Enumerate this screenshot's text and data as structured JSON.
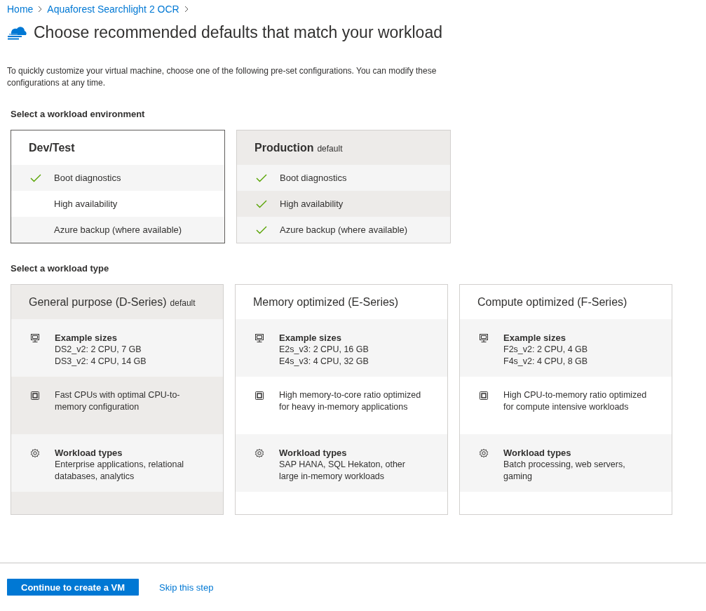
{
  "breadcrumb": [
    {
      "label": "Home"
    },
    {
      "label": "Aquaforest Searchlight 2 OCR"
    }
  ],
  "title": "Choose recommended defaults that match your workload",
  "description": "To quickly customize your virtual machine, choose one of the following pre-set configurations. You can modify these configurations at any time.",
  "environment_section": {
    "label": "Select a workload environment",
    "cards": [
      {
        "title": "Dev/Test",
        "selected": true,
        "shaded": false,
        "features": [
          {
            "label": "Boot diagnostics",
            "checked": true
          },
          {
            "label": "High availability",
            "checked": false
          },
          {
            "label": "Azure backup (where available)",
            "checked": false
          }
        ]
      },
      {
        "title": "Production",
        "tag": "default",
        "selected": false,
        "shaded": true,
        "features": [
          {
            "label": "Boot diagnostics",
            "checked": true
          },
          {
            "label": "High availability",
            "checked": true
          },
          {
            "label": "Azure backup (where available)",
            "checked": true
          }
        ]
      }
    ]
  },
  "type_section": {
    "label": "Select a workload type",
    "cards": [
      {
        "title": "General purpose (D-Series)",
        "tag": "default",
        "selected": false,
        "shaded": true,
        "rows": [
          {
            "kind": "sizes",
            "heading": "Example sizes",
            "lines": [
              "DS2_v2: 2 CPU, 7 GB",
              "DS3_v2: 4 CPU, 14 GB"
            ]
          },
          {
            "kind": "cpu",
            "lines": [
              "Fast CPUs with optimal CPU-to-memory configuration"
            ]
          },
          {
            "kind": "workloads",
            "heading": "Workload types",
            "lines": [
              "Enterprise applications, relational databases, analytics"
            ]
          }
        ]
      },
      {
        "title": "Memory optimized (E-Series)",
        "selected": false,
        "shaded": false,
        "rows": [
          {
            "kind": "sizes",
            "heading": "Example sizes",
            "lines": [
              "E2s_v3: 2 CPU, 16 GB",
              "E4s_v3: 4 CPU, 32 GB"
            ]
          },
          {
            "kind": "cpu",
            "lines": [
              "High memory-to-core ratio optimized for heavy in-memory applications"
            ]
          },
          {
            "kind": "workloads",
            "heading": "Workload types",
            "lines": [
              "SAP HANA, SQL Hekaton, other large in-memory workloads"
            ]
          }
        ]
      },
      {
        "title": "Compute optimized (F-Series)",
        "selected": false,
        "shaded": false,
        "rows": [
          {
            "kind": "sizes",
            "heading": "Example sizes",
            "lines": [
              "F2s_v2: 2 CPU, 4 GB",
              "F4s_v2: 4 CPU, 8 GB"
            ]
          },
          {
            "kind": "cpu",
            "lines": [
              "High CPU-to-memory ratio optimized for compute intensive workloads"
            ]
          },
          {
            "kind": "workloads",
            "heading": "Workload types",
            "lines": [
              "Batch processing, web servers, gaming"
            ]
          }
        ]
      }
    ]
  },
  "footer": {
    "primary_button": "Continue to create a VM",
    "link": "Skip this step"
  }
}
